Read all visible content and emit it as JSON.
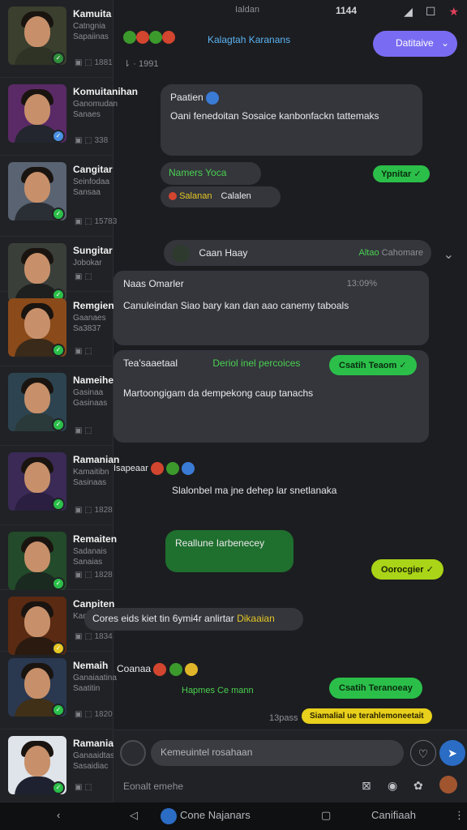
{
  "status_bar": {
    "left_text": "Ialdan",
    "time": "1144"
  },
  "contacts": [
    {
      "name": "Kamuita",
      "sub1": "Catngnia",
      "sub2": "Sapaiinas",
      "meta": "1881",
      "colors": {
        "bg": "#3a3f2e",
        "body": "#2e3326"
      }
    },
    {
      "name": "Komuitanihan",
      "sub1": "Ganomudan",
      "sub2": "Sanaes",
      "meta": "338",
      "colors": {
        "bg": "#5a2a66",
        "body": "#23262e"
      }
    },
    {
      "name": "Cangitar",
      "sub1": "Seinfodaa",
      "sub2": "Sansaa",
      "meta": "15783",
      "colors": {
        "bg": "#596372",
        "body": "#2a2e35"
      }
    },
    {
      "name": "Sungitar",
      "sub1": "Jobokar",
      "sub2": "",
      "meta": "",
      "colors": {
        "bg": "#3b3f3a",
        "body": "#1e2020"
      }
    },
    {
      "name": "Remgien",
      "sub1": "Gaanaes",
      "sub2": "Sa3837",
      "meta": "",
      "colors": {
        "bg": "#8a4a1a",
        "body": "#3a2a1a"
      }
    },
    {
      "name": "Nameihe",
      "sub1": "Gasinaa",
      "sub2": "Gasinaas",
      "meta": "",
      "colors": {
        "bg": "#2d4450",
        "body": "#2a3a3a"
      }
    },
    {
      "name": "Ramanian",
      "sub1": "Kamaitibn",
      "sub2": "Sasinaas",
      "meta": "1828",
      "colors": {
        "bg": "#3a2a55",
        "body": "#2a1f40"
      }
    },
    {
      "name": "Remaiten",
      "sub1": "Sadanais",
      "sub2": "Sanaias",
      "meta": "1828",
      "colors": {
        "bg": "#234a2a",
        "body": "#1b2a20"
      }
    },
    {
      "name": "Canpiten",
      "sub1": "Kammsoaeh",
      "sub2": "",
      "meta": "1834",
      "colors": {
        "bg": "#5a2a12",
        "body": "#2a1a10"
      }
    },
    {
      "name": "Nemaih",
      "sub1": "Ganaiaatina",
      "sub2": "Saatitin",
      "meta": "1820",
      "colors": {
        "bg": "#2a3850",
        "body": "#403018"
      }
    },
    {
      "name": "Ramaniaa",
      "sub1": "Ganaaidtas",
      "sub2": "Sasaidiac",
      "meta": "",
      "colors": {
        "bg": "#dfe3ea",
        "body": "#1e2230"
      }
    }
  ],
  "header": {
    "group_title": "Kalagtah Karanans",
    "dropdown_label": "Datitaive"
  },
  "messages": {
    "m1_title": "Paatien",
    "m1_text": "Oani fenedoitan Sosaice kanbonfackn tattemaks",
    "m2_title": "Namers Yoca",
    "m2_pill": "Ypnitar",
    "m2_chip1": "Salanan",
    "m2_chip2": "Calalen",
    "m3_name": "Caan Haay",
    "m3_tag": "Altao",
    "m3_tag2": "Cahomare",
    "m4_title": "Naas Omarler",
    "m4_time": "13:09%",
    "m4_text": "Canuleindan Siao bary kan dan aao canemy taboals",
    "m5_title": "Tea'saaetaal",
    "m5_subtitle": "Deriol inel percoices",
    "m5_pill": "Csatih Teaom",
    "m5_text": "Martoongigam da dempekong caup tanachs",
    "m6_prefix": "Isapeaar",
    "m6_text": "Slalonbel ma jne dehep lar snetlanaka",
    "m7_text": "Reallune Iarbenecey",
    "m7_pill": "Oorocgier",
    "m8_text": "Cores eids kiet tin 6ymi4r anlirtar",
    "m8_highlight": "Dikaaian",
    "m9_prefix": "Coanaa",
    "m9_green": "Hapmes Ce mann",
    "m9_pill": "Csatih Teranoeay",
    "m9_time": "13pass",
    "m9_yellow": "Siamalial ue terahlemoneetait"
  },
  "composer": {
    "placeholder": "Kemeuintel rosahaan",
    "hint": "Eonalt emehe"
  },
  "navbar": {
    "center_label": "Cone Najanars",
    "right_label": "Canifiaah"
  }
}
